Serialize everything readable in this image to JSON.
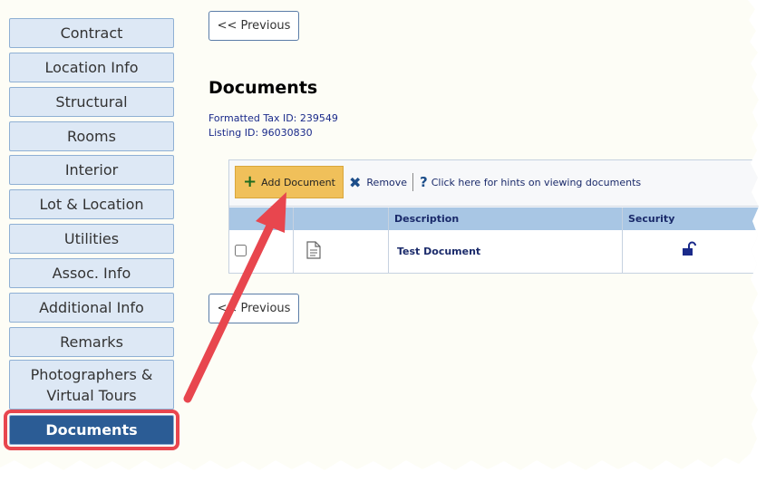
{
  "sidebar": {
    "items": [
      {
        "label": "Contract"
      },
      {
        "label": "Location Info"
      },
      {
        "label": "Structural"
      },
      {
        "label": "Rooms"
      },
      {
        "label": "Interior"
      },
      {
        "label": "Lot & Location"
      },
      {
        "label": "Utilities"
      },
      {
        "label": "Assoc. Info"
      },
      {
        "label": "Additional Info"
      },
      {
        "label": "Remarks"
      },
      {
        "label": "Photographers & Virtual Tours"
      },
      {
        "label": "Documents",
        "active": true
      }
    ]
  },
  "nav": {
    "previous_top": "<< Previous",
    "previous_bottom": "<< Previous"
  },
  "page": {
    "title": "Documents",
    "tax_id_label": "Formatted Tax ID: 239549",
    "listing_id_label": "Listing ID: 96030830"
  },
  "toolbar": {
    "add_label": "Add Document",
    "remove_label": "Remove",
    "hints_label": "Click here for hints on viewing documents"
  },
  "table": {
    "headers": {
      "description": "Description",
      "security": "Security"
    },
    "rows": [
      {
        "description": "Test Document",
        "checked": false
      }
    ]
  },
  "colors": {
    "nav_bg": "#dde8f5",
    "nav_active": "#2b5c95",
    "highlight": "#e8464e",
    "add_button": "#f0c05a",
    "table_header": "#a8c6e4"
  }
}
